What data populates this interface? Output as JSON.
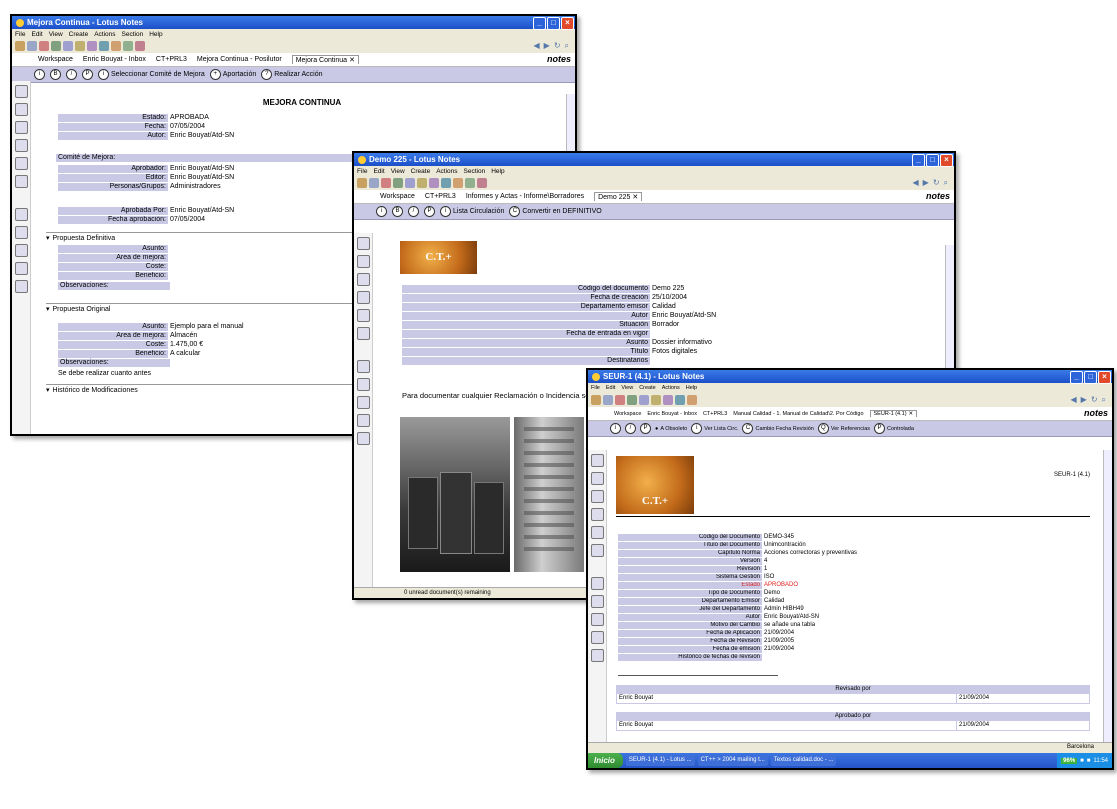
{
  "menu": [
    "File",
    "Edit",
    "View",
    "Create",
    "Actions",
    "Section",
    "Help"
  ],
  "win1": {
    "title": "Mejora Continua - Lotus Notes",
    "tabs": [
      "Workspace",
      "Enric Bouyat - Inbox",
      "CT+PRL3",
      "Mejora Continua - Posilutor",
      "Mejora Continua"
    ],
    "notes": "notes",
    "actions": [
      "Seleccionar Comité de Mejora",
      "Aportación",
      "Realizar Acción"
    ],
    "heading": "MEJORA CONTINUA",
    "top_fields": [
      {
        "label": "Estado:",
        "value": "APROBADA"
      },
      {
        "label": "Fecha:",
        "value": "07/05/2004"
      },
      {
        "label": "Autor:",
        "value": "Enric Bouyat/Atd-SN"
      }
    ],
    "comite_label": "Comité de Mejora:",
    "comite_fields": [
      {
        "label": "Aprobador:",
        "value": "Enric Bouyat/Atd-SN"
      },
      {
        "label": "Editor:",
        "value": "Enric Bouyat/Atd-SN"
      },
      {
        "label": "Personas/Grupos:",
        "value": "Administradores"
      }
    ],
    "aprob_fields": [
      {
        "label": "Aprobada Por:",
        "value": "Enric Bouyat/Atd-SN"
      },
      {
        "label": "Fecha aprobación:",
        "value": "07/05/2004"
      }
    ],
    "section_definitiva": "Propuesta Definitiva",
    "def_fields": [
      {
        "label": "Asunto:",
        "value": ""
      },
      {
        "label": "Área de mejora:",
        "value": ""
      },
      {
        "label": "Coste:",
        "value": ""
      },
      {
        "label": "Beneficio:",
        "value": ""
      }
    ],
    "observaciones": "Observaciones:",
    "section_original": "Propuesta Original",
    "orig_fields": [
      {
        "label": "Asunto:",
        "value": "Ejemplo para el manual"
      },
      {
        "label": "Área de mejora:",
        "value": "Almacén"
      },
      {
        "label": "Coste:",
        "value": "1.475,00 €"
      },
      {
        "label": "Beneficio:",
        "value": "A calcular"
      }
    ],
    "observaciones2": "Observaciones:",
    "note": "Se debe realizar cuanto antes",
    "section_historico": "Histórico de Modificaciones"
  },
  "win2": {
    "title": "Demo 225 - Lotus Notes",
    "tabs": [
      "Workspace",
      "CT+PRL3",
      "Informes y Actas - Informe\\Borradores",
      "Demo 225"
    ],
    "notes": "notes",
    "actions": [
      "Lista Circulación",
      "Convertir en DEFINITIVO"
    ],
    "logo": "C.T.+",
    "fields": [
      {
        "label": "Código del documento",
        "value": "Demo 225"
      },
      {
        "label": "Fecha de creación",
        "value": "25/10/2004"
      },
      {
        "label": "Departamento emisor",
        "value": "Calidad"
      },
      {
        "label": "Autor",
        "value": "Enric Bouyat/Atd-SN"
      },
      {
        "label": "Situación",
        "value": "Borrador"
      },
      {
        "label": "Fecha de entrada en vigor",
        "value": ""
      },
      {
        "label": "Asunto",
        "value": "Dossier informativo"
      },
      {
        "label": "Título",
        "value": "Fotos digitales"
      },
      {
        "label": "Destinatarios",
        "value": ""
      }
    ],
    "body_text": "Para documentar cualquier Reclamación o Incidencia se r",
    "status": "0 unread document(s) remaining"
  },
  "win3": {
    "title": "SEUR-1 (4.1) - Lotus Notes",
    "tabs": [
      "Workspace",
      "Enric Bouyat - Inbox",
      "CT+PRL3",
      "Manual Calidad - 1. Manual de Calidad\\2. Por Código",
      "SEUR-1 (4.1)"
    ],
    "notes": "notes",
    "actions": [
      "A Obsoleto",
      "Ver Lista Circ.",
      "Cambio Fecha Revisión",
      "Ver Referencias",
      "Controlada"
    ],
    "doc_id": "SEUR-1 (4.1)",
    "logo": "C.T.+",
    "fields": [
      {
        "label": "Código del Documento",
        "value": "DEMO-345",
        "red": false
      },
      {
        "label": "Título del Documento",
        "value": "Unimcontración",
        "red": false
      },
      {
        "label": "Capítulo Norma",
        "value": "Acciones correctoras y preventivas",
        "red": false
      },
      {
        "label": "Versión",
        "value": "4",
        "red": false
      },
      {
        "label": "Revisión",
        "value": "1",
        "red": false
      },
      {
        "label": "Sistema Gestión",
        "value": "ISO",
        "red": false
      },
      {
        "label": "Estado",
        "value": "APROBADO",
        "red": true
      },
      {
        "label": "Tipo de Documento",
        "value": "Demo",
        "red": false
      },
      {
        "label": "Departamento Emisor",
        "value": "Calidad",
        "red": false
      },
      {
        "label": "Jefe del Departamento",
        "value": "Admin HIBH49",
        "red": false
      },
      {
        "label": "Autor",
        "value": "Enric Bouyat/Atd-SN",
        "red": false
      },
      {
        "label": "Motivo del Cambio",
        "value": "se añade una tabla",
        "red": false
      },
      {
        "label": "Fecha de Aplicación",
        "value": "21/09/2004",
        "red": false
      },
      {
        "label": "Fecha de Revisión",
        "value": "21/09/2005",
        "red": false
      },
      {
        "label": "Fecha de emisión",
        "value": "21/09/2004",
        "red": false
      },
      {
        "label": "Histórico de fechas de revisión",
        "value": "",
        "red": false
      }
    ],
    "revisado_header": "Revisado por",
    "revisado_name": "Enric Bouyat",
    "revisado_date": "21/09/2004",
    "aprobado_header": "Aprobado por",
    "aprobado_name": "Enric Bouyat",
    "aprobado_date": "21/09/2004",
    "status_location": "Barcelona",
    "taskbar": {
      "start": "Inicio",
      "tasks": [
        "SEUR-1 (4.1) - Lotus ...",
        "CT++ > 2004 mailing t...",
        "Textos calidad.doc - ..."
      ],
      "time": "11:54",
      "percent": "96%"
    }
  }
}
